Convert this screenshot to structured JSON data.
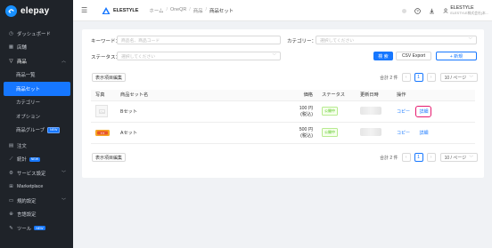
{
  "sidebar": {
    "logo_text": "elepay",
    "items": [
      {
        "label": "ダッシュボード",
        "icon": "dashboard-icon"
      },
      {
        "label": "店舗",
        "icon": "store-icon"
      },
      {
        "label": "商品",
        "icon": "product-icon"
      },
      {
        "label": "商品一覧"
      },
      {
        "label": "商品セット"
      },
      {
        "label": "カテゴリー"
      },
      {
        "label": "オプション"
      },
      {
        "label": "商品グループ",
        "badge": "NEW"
      },
      {
        "label": "注文",
        "icon": "order-icon"
      },
      {
        "label": "統計",
        "badge": "NEW",
        "icon": "chart-icon"
      },
      {
        "label": "サービス設定",
        "icon": "gear-icon"
      },
      {
        "label": "Marketplace",
        "icon": "grid-icon"
      },
      {
        "label": "規約設定",
        "icon": "doc-icon"
      },
      {
        "label": "言語設定",
        "icon": "globe-icon"
      },
      {
        "label": "ツール",
        "badge": "NEW",
        "icon": "tool-icon"
      }
    ]
  },
  "header": {
    "brand": "ELESTYLE",
    "breadcrumb": [
      "ホーム",
      "OneQR",
      "商品",
      "商品セット"
    ],
    "user_name": "ELESTYLE",
    "user_sub": "ELESTYLE株式会社(本..."
  },
  "filters": {
    "keyword_label": "キーワード：",
    "keyword_placeholder": "商品名、商品コード",
    "category_label": "カテゴリー：",
    "category_placeholder": "選択してください",
    "status_label": "ステータス：",
    "status_placeholder": "選択してください",
    "search_btn": "検 索",
    "csv_btn": "CSV Export",
    "new_btn": "+ 新規"
  },
  "toolbar": {
    "edit_columns": "表示項目編集"
  },
  "pagination": {
    "total": "合計 2 件",
    "current": "1",
    "page_size": "10 / ページ"
  },
  "table": {
    "headers": [
      "写真",
      "商品セット名",
      "価格",
      "ステータス",
      "更新日時",
      "操作"
    ],
    "rows": [
      {
        "name": "Bセット",
        "price": "100 円 (税込)",
        "status": "公開中",
        "copy": "コピー",
        "detail": "詳細"
      },
      {
        "name": "Aセット",
        "price": "500 円 (税込)",
        "status": "公開中",
        "copy": "コピー",
        "detail": "詳細"
      }
    ]
  },
  "colors": {
    "sidebar_bg": "#1f2329",
    "accent": "#1677ff",
    "highlight": "#e6196e",
    "status_green": "#52c41a"
  }
}
